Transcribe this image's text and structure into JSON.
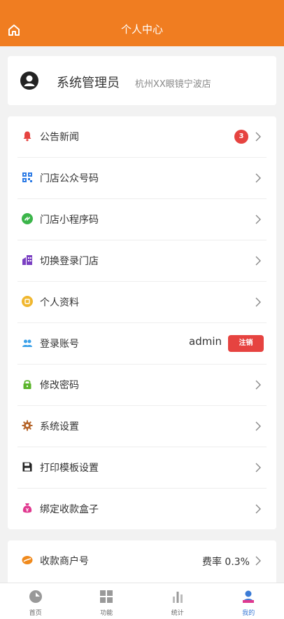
{
  "header": {
    "title": "个人中心",
    "home_icon": "home-icon"
  },
  "profile": {
    "name": "系统管理员",
    "store": "杭州XX眼镜宁波店"
  },
  "menu": {
    "notice": {
      "label": "公告新闻",
      "badge": "3"
    },
    "store_qr": {
      "label": "门店公众号码"
    },
    "miniprogram": {
      "label": "门店小程序码"
    },
    "switch_store": {
      "label": "切换登录门店"
    },
    "personal": {
      "label": "个人资料"
    },
    "account": {
      "label": "登录账号",
      "value": "admin",
      "logout": "注销"
    },
    "password": {
      "label": "修改密码"
    },
    "settings": {
      "label": "系统设置"
    },
    "print": {
      "label": "打印模板设置"
    },
    "box": {
      "label": "绑定收款盒子"
    }
  },
  "merchant": {
    "label": "收款商户号",
    "rate": "费率 0.3%"
  },
  "tabs": [
    {
      "label": "首页"
    },
    {
      "label": "功能"
    },
    {
      "label": "统计"
    },
    {
      "label": "我的"
    }
  ],
  "colors": {
    "brand": "#f07d21",
    "danger": "#e64340",
    "active_tab": "#3b7bd6"
  }
}
